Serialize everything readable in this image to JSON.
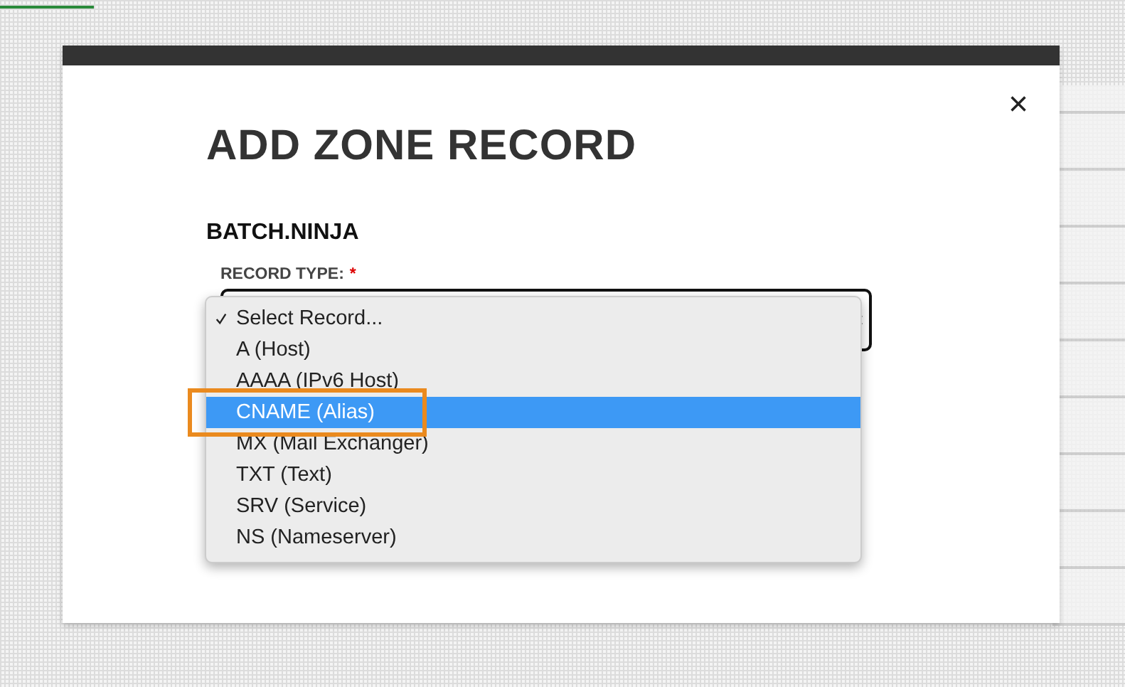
{
  "dialog": {
    "title": "ADD ZONE RECORD",
    "close": "×",
    "domain": "BATCH.NINJA",
    "field": {
      "label": "RECORD TYPE:",
      "required_mark": "*",
      "options": [
        {
          "label": "Select Record...",
          "checked": true,
          "highlighted": false,
          "annotated": false
        },
        {
          "label": "A (Host)",
          "checked": false,
          "highlighted": false,
          "annotated": false
        },
        {
          "label": "AAAA (IPv6 Host)",
          "checked": false,
          "highlighted": false,
          "annotated": false
        },
        {
          "label": "CNAME (Alias)",
          "checked": false,
          "highlighted": true,
          "annotated": true
        },
        {
          "label": "MX (Mail Exchanger)",
          "checked": false,
          "highlighted": false,
          "annotated": false
        },
        {
          "label": "TXT (Text)",
          "checked": false,
          "highlighted": false,
          "annotated": false
        },
        {
          "label": "SRV (Service)",
          "checked": false,
          "highlighted": false,
          "annotated": false
        },
        {
          "label": "NS (Nameserver)",
          "checked": false,
          "highlighted": false,
          "annotated": false
        }
      ]
    }
  }
}
